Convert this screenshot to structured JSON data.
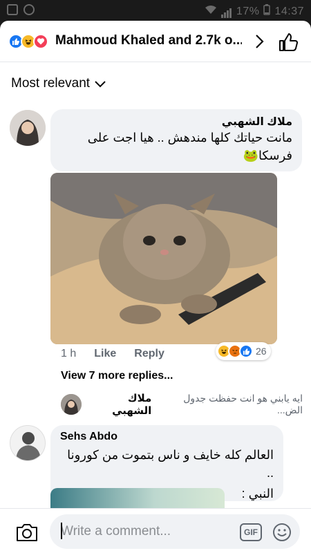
{
  "statusbar": {
    "battery": "17%",
    "time": "14:37"
  },
  "header": {
    "title": "Mahmoud Khaled and 2.7k o...",
    "reaction_icons": [
      "like-icon",
      "haha-icon",
      "love-icon"
    ]
  },
  "sort": {
    "label": "Most relevant"
  },
  "comment1": {
    "author": "ملاك الشهبي",
    "text_line1": "مانت حياتك كلها مندهش .. هيا اجت على",
    "text_line2": "فرسكا🐸",
    "time": "1 h",
    "like_label": "Like",
    "reply_label": "Reply",
    "reaction_count": "26",
    "reaction_icons": [
      "haha-icon",
      "angry-icon",
      "like-icon"
    ],
    "view_more": "View 7 more replies..."
  },
  "reply_preview": {
    "author": "ملاك الشهبي",
    "text": "ايه يابني هو انت حفظت جدول الض..."
  },
  "comment2": {
    "author": "Sehs Abdo",
    "text_line1": "العالم كله خايف و ناس بتموت من كورونا ..",
    "text_line2": "النبي :"
  },
  "composer": {
    "placeholder": "Write a comment...",
    "gif_label": "GIF"
  },
  "colors": {
    "like": "#1877f2",
    "haha": "#f7b928",
    "love": "#f33e58",
    "angry": "#e9710f",
    "bubble": "#f0f2f5"
  }
}
